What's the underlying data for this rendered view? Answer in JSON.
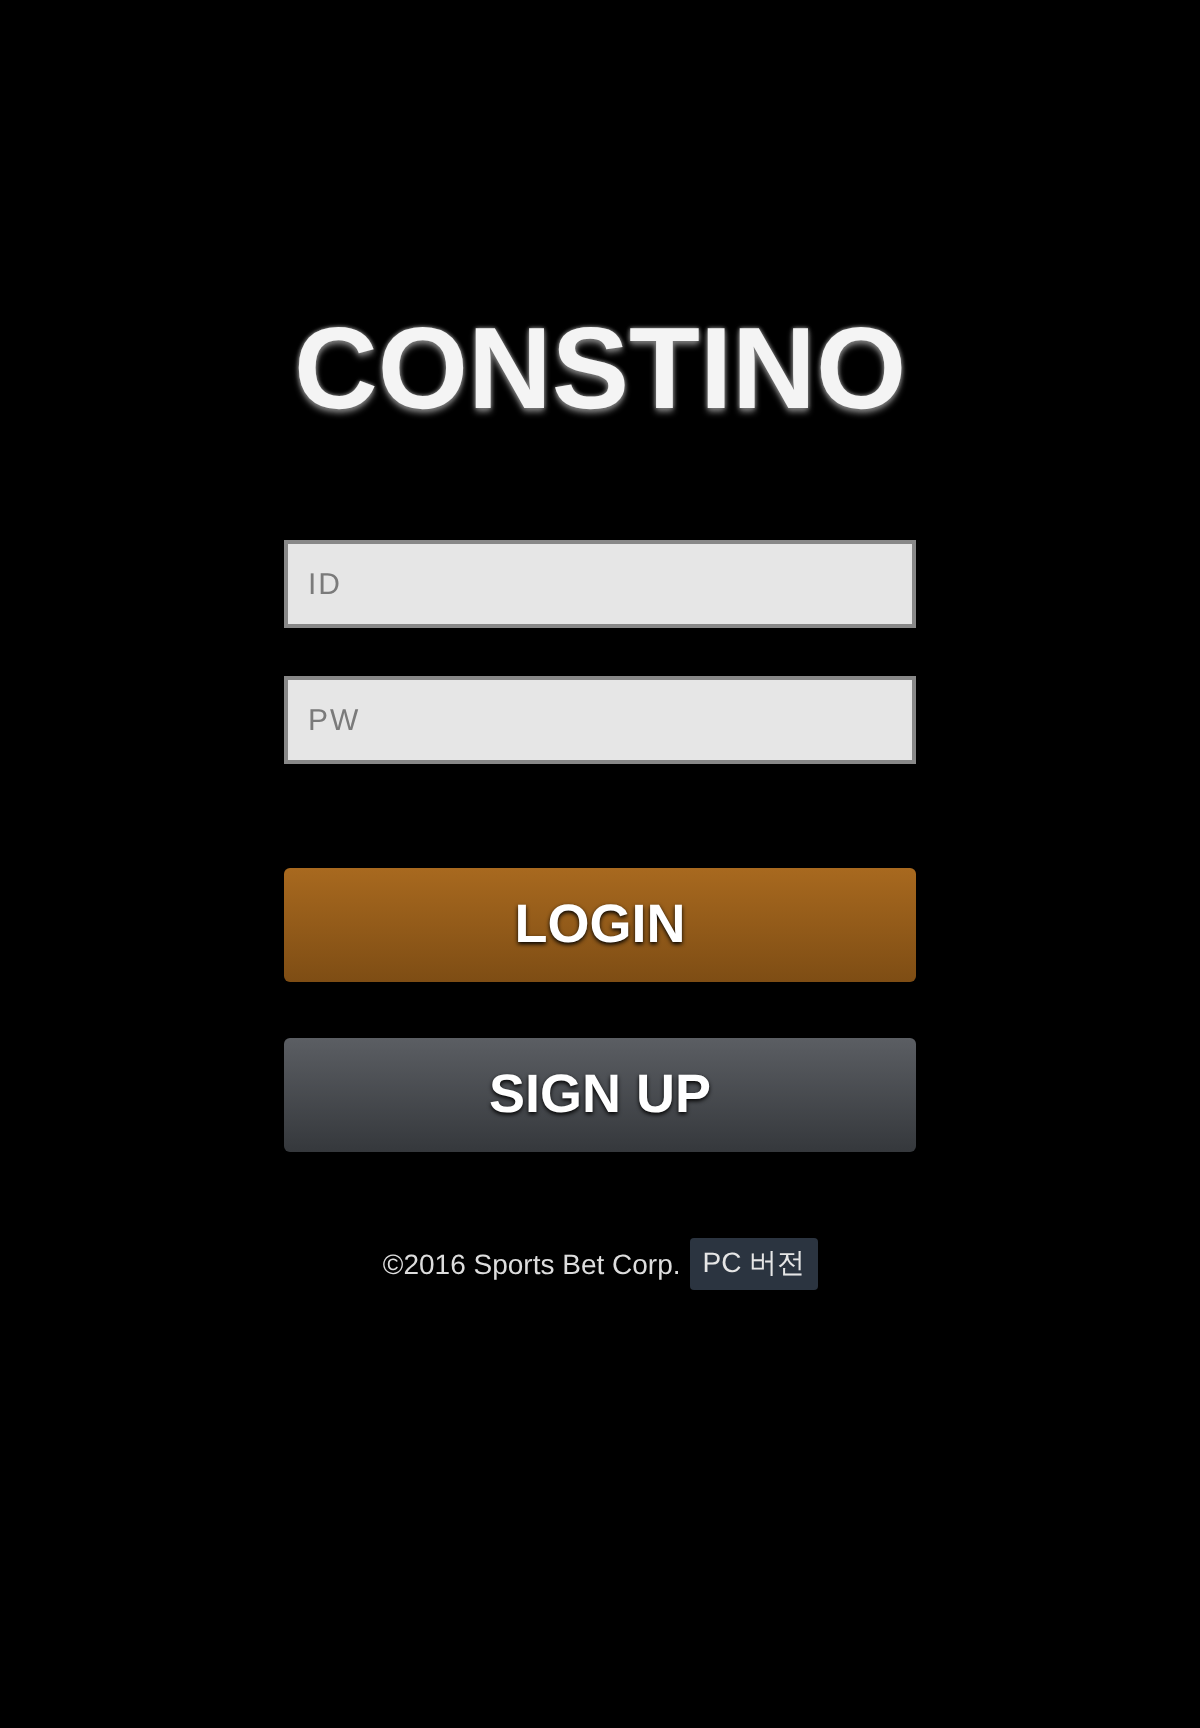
{
  "logo": "CONSTINO",
  "fields": [
    {
      "placeholder": "ID"
    },
    {
      "placeholder": "PW"
    }
  ],
  "buttons": [
    {
      "label": "LOGIN",
      "kind": "primary"
    },
    {
      "label": "SIGN UP",
      "kind": "secondary"
    }
  ],
  "footer": {
    "copyright": "©2016 Sports Bet Corp.",
    "pc_version_link": "PC 버전"
  }
}
